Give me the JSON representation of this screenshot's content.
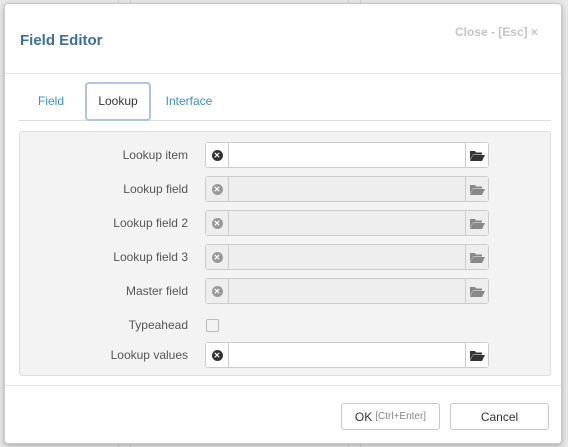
{
  "dialog": {
    "title": "Field Editor",
    "close_label": "Close - [Esc] ×"
  },
  "tabs": [
    {
      "label": "Field",
      "active": false
    },
    {
      "label": "Lookup",
      "active": true
    },
    {
      "label": "Interface",
      "active": false
    }
  ],
  "form": {
    "lookup_item": {
      "label": "Lookup item",
      "value": "",
      "enabled": true
    },
    "lookup_field": {
      "label": "Lookup field",
      "value": "",
      "enabled": false
    },
    "lookup_field_2": {
      "label": "Lookup field 2",
      "value": "",
      "enabled": false
    },
    "lookup_field_3": {
      "label": "Lookup field 3",
      "value": "",
      "enabled": false
    },
    "master_field": {
      "label": "Master field",
      "value": "",
      "enabled": false
    },
    "typeahead": {
      "label": "Typeahead",
      "checked": false
    },
    "lookup_values": {
      "label": "Lookup values",
      "value": "",
      "enabled": true
    }
  },
  "footer": {
    "ok_label": "OK",
    "ok_hint": "[Ctrl+Enter]",
    "cancel_label": "Cancel"
  },
  "icons": {
    "clear": "clear-icon",
    "browse": "folder-open-icon"
  },
  "colors": {
    "title": "#3d6f9c",
    "tab_link": "#3a8fd0",
    "active_tab_border": "#adc6e8"
  }
}
